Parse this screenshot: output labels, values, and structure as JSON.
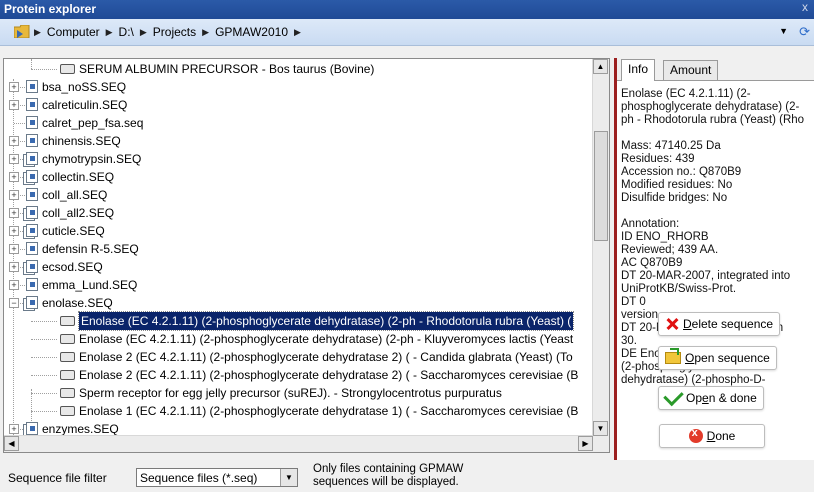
{
  "window": {
    "title": "Protein explorer",
    "close_glyph": "x"
  },
  "breadcrumb": [
    "Computer",
    "D:\\",
    "Projects",
    "GPMAW2010"
  ],
  "tree": {
    "top_sequence": "SERUM ALBUMIN PRECURSOR - Bos taurus (Bovine)",
    "files_before": [
      "bsa_noSS.SEQ",
      "calreticulin.SEQ",
      "calret_pep_fsa.seq",
      "chinensis.SEQ",
      "chymotrypsin.SEQ",
      "collectin.SEQ",
      "coll_all.SEQ",
      "coll_all2.SEQ",
      "cuticle.SEQ",
      "defensin R-5.SEQ",
      "ecsod.SEQ",
      "emma_Lund.SEQ"
    ],
    "expanded_file": "enolase.SEQ",
    "sequences": [
      "Enolase (EC 4.2.1.11) (2-phosphoglycerate dehydratase) (2-ph - Rhodotorula rubra (Yeast) (",
      "Enolase (EC 4.2.1.11) (2-phosphoglycerate dehydratase) (2-ph - Kluyveromyces lactis (Yeast",
      "Enolase 2 (EC 4.2.1.11) (2-phosphoglycerate dehydratase 2) ( - Candida glabrata (Yeast) (To",
      "Enolase 2 (EC 4.2.1.11) (2-phosphoglycerate dehydratase 2) ( - Saccharomyces cerevisiae (B",
      "Sperm receptor for egg jelly precursor (suREJ). - Strongylocentrotus purpuratus",
      "Enolase 1 (EC 4.2.1.11) (2-phosphoglycerate dehydratase 1) ( - Saccharomyces cerevisiae (B"
    ],
    "files_after": [
      "enzymes.SEQ"
    ],
    "selected_index": 0
  },
  "panel": {
    "tabs": [
      "Info",
      "Amount"
    ],
    "active_tab": "Info",
    "description": "Enolase (EC 4.2.1.11) (2-phosphoglycerate dehydratase) (2-ph - Rhodotorula rubra (Yeast) (Rho",
    "mass": "Mass:  47140.25 Da",
    "residues": "Residues: 439",
    "accession": "Accession no.: Q870B9",
    "modified": "Modified residues: No",
    "disulfide": "Disulfide bridges: No",
    "annotation_label": "Annotation:",
    "annotation_lines": [
      "ID   ENO_RHORB",
      "Reviewed;        439 AA.",
      "AC   Q870B9",
      "DT   20-MAR-2007, integrated into",
      "UniProtKB/Swiss-Prot.",
      "DT   0",
      "version",
      "DT   20-MAR-2007, entry version",
      "30.",
      "DE   Enolase (EC 4.2.1.11)",
      "(2-phosphoglycerate",
      "dehydratase) (2-phospho-D-"
    ]
  },
  "actions": {
    "delete": {
      "pre": "",
      "key": "D",
      "post": "elete sequence"
    },
    "open": {
      "pre": "",
      "key": "O",
      "post": "pen sequence"
    },
    "open_done": {
      "pre": "Op",
      "key": "e",
      "post": "n & done"
    },
    "done": {
      "pre": "",
      "key": "D",
      "post": "one"
    }
  },
  "filter": {
    "label": "Sequence file filter",
    "value": "Sequence files (*.seq)",
    "note_line1": "Only files containing GPMAW",
    "note_line2": "sequences will be displayed."
  }
}
